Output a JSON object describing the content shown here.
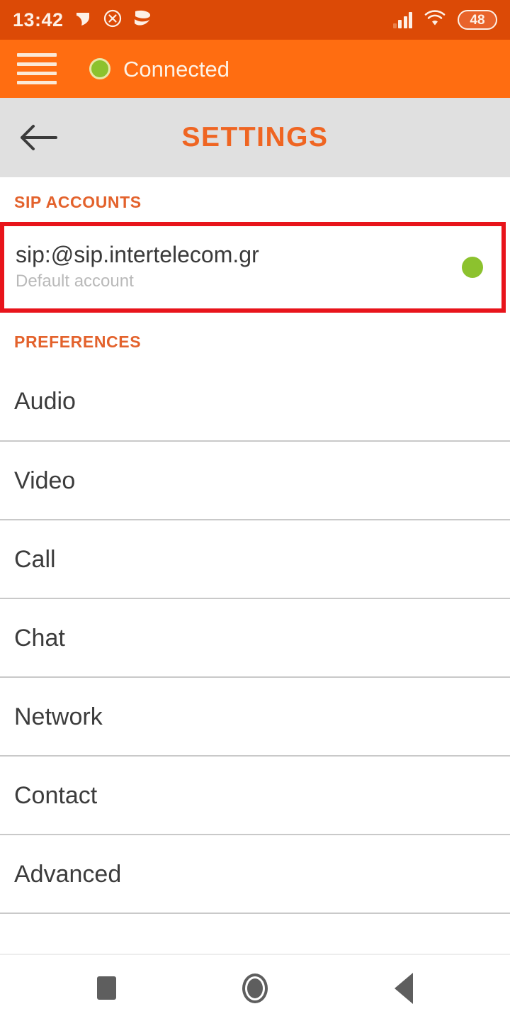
{
  "status_bar": {
    "time": "13:42",
    "notification_icons": [
      "pennant-icon",
      "close-circle-icon",
      "chat-bubbles-icon"
    ],
    "signal_icon": "cellular-signal-icon",
    "wifi_icon": "wifi-icon",
    "battery_level": "48",
    "background_color": "#dc4a06"
  },
  "app_bar": {
    "menu_icon": "hamburger-menu-icon",
    "status_dot_color": "#8cc22e",
    "status_text": "Connected",
    "background_color": "#ff6d11"
  },
  "title_bar": {
    "back_icon": "back-arrow-icon",
    "title": "SETTINGS",
    "title_color": "#ef6522",
    "background_color": "#e0e0e0"
  },
  "sip_accounts": {
    "section_label": "SIP ACCOUNTS",
    "highlight_color": "#e8141b",
    "account": {
      "uri": "sip:@sip.intertelecom.gr",
      "subtitle": "Default account",
      "status_dot_color": "#8cc22e"
    }
  },
  "preferences": {
    "section_label": "PREFERENCES",
    "items": [
      {
        "label": "Audio"
      },
      {
        "label": "Video"
      },
      {
        "label": "Call"
      },
      {
        "label": "Chat"
      },
      {
        "label": "Network"
      },
      {
        "label": "Contact"
      },
      {
        "label": "Advanced"
      }
    ]
  },
  "nav_bar": {
    "recents_icon": "square-recents-icon",
    "home_icon": "circle-home-icon",
    "back_icon": "triangle-back-icon"
  }
}
